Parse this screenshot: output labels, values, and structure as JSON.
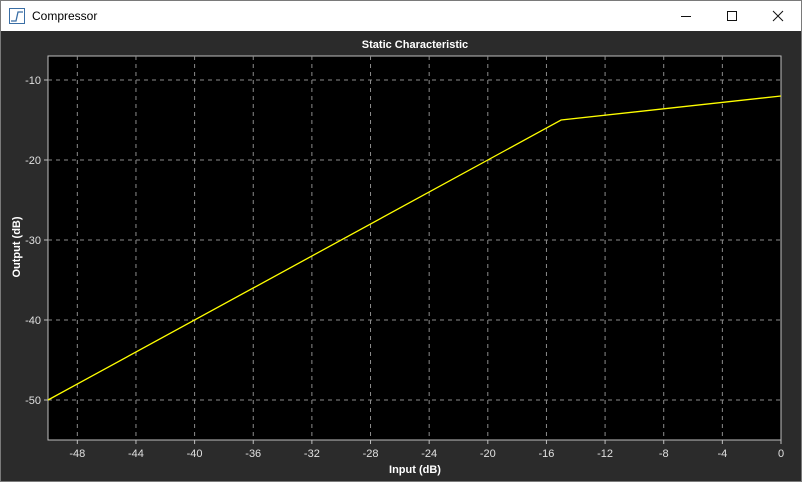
{
  "window": {
    "title": "Compressor",
    "controls": [
      "minimize",
      "maximize",
      "close"
    ]
  },
  "chart_data": {
    "type": "line",
    "title": "Static Characteristic",
    "xlabel": "Input (dB)",
    "ylabel": "Output (dB)",
    "xlim": [
      -50,
      0
    ],
    "ylim": [
      -55,
      -7
    ],
    "xticks": [
      -48,
      -44,
      -40,
      -36,
      -32,
      -28,
      -24,
      -20,
      -16,
      -12,
      -8,
      -4,
      0
    ],
    "yticks": [
      -50,
      -40,
      -30,
      -20,
      -10
    ],
    "grid": true,
    "background": "#000000",
    "line_color": "#ffff00",
    "series": [
      {
        "x": [
          -50,
          -15,
          0
        ],
        "y": [
          -50,
          -15,
          -12
        ]
      }
    ]
  }
}
